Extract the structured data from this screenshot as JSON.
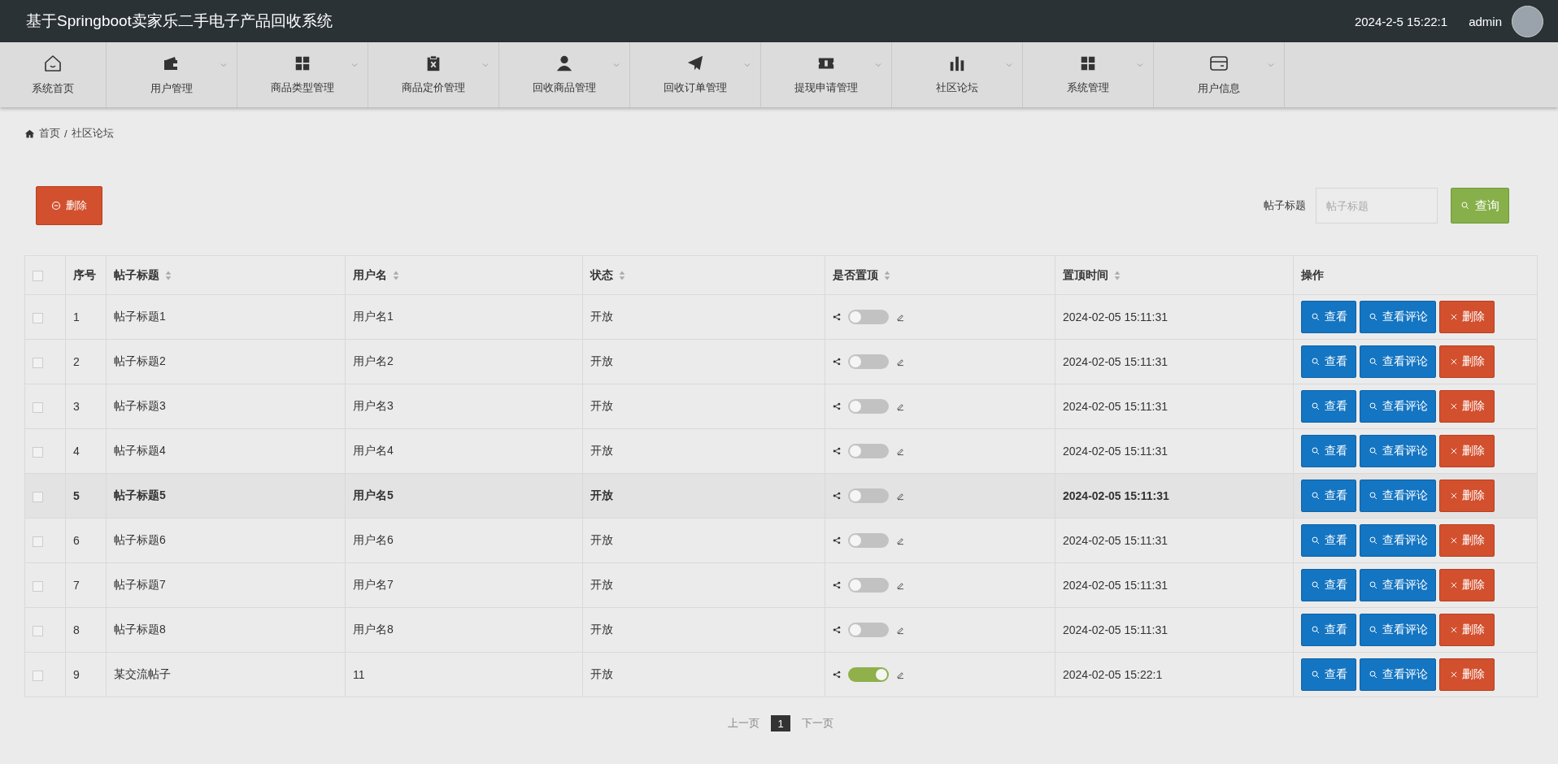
{
  "header": {
    "title": "基于Springboot卖家乐二手电子产品回收系统",
    "datetime": "2024-2-5 15:22:1",
    "user": "admin"
  },
  "nav": [
    {
      "label": "系统首页",
      "dropdown": false
    },
    {
      "label": "用户管理",
      "dropdown": true
    },
    {
      "label": "商品类型管理",
      "dropdown": true
    },
    {
      "label": "商品定价管理",
      "dropdown": true
    },
    {
      "label": "回收商品管理",
      "dropdown": true
    },
    {
      "label": "回收订单管理",
      "dropdown": true
    },
    {
      "label": "提现申请管理",
      "dropdown": true
    },
    {
      "label": "社区论坛",
      "dropdown": true
    },
    {
      "label": "系统管理",
      "dropdown": true
    },
    {
      "label": "用户信息",
      "dropdown": true
    }
  ],
  "breadcrumb": [
    "首页",
    "/",
    "社区论坛"
  ],
  "toolbar": {
    "delete_button": "删除",
    "search_label": "帖子标题",
    "search": {
      "placeholder": "帖子标题"
    },
    "query_button": "查询"
  },
  "table": {
    "select_all_checked": false,
    "columns": [
      {
        "label": "序号",
        "sortable": false
      },
      {
        "label": "帖子标题",
        "sortable": true
      },
      {
        "label": "用户名",
        "sortable": true
      },
      {
        "label": "状态",
        "sortable": true
      },
      {
        "label": "是否置顶",
        "sortable": true
      },
      {
        "label": "置顶时间",
        "sortable": true
      },
      {
        "label": "操作",
        "sortable": false
      }
    ],
    "rows": [
      {
        "checked": false,
        "selected": false,
        "index": "1",
        "title": "帖子标题1",
        "username": "用户名1",
        "status": "开放",
        "pinned": false,
        "time": "2024-02-05 15:11:31",
        "actions": [
          "查看",
          "查看评论",
          "删除"
        ]
      },
      {
        "checked": false,
        "selected": false,
        "index": "2",
        "title": "帖子标题2",
        "username": "用户名2",
        "status": "开放",
        "pinned": false,
        "time": "2024-02-05 15:11:31",
        "actions": [
          "查看",
          "查看评论",
          "删除"
        ]
      },
      {
        "checked": false,
        "selected": false,
        "index": "3",
        "title": "帖子标题3",
        "username": "用户名3",
        "status": "开放",
        "pinned": false,
        "time": "2024-02-05 15:11:31",
        "actions": [
          "查看",
          "查看评论",
          "删除"
        ]
      },
      {
        "checked": false,
        "selected": false,
        "index": "4",
        "title": "帖子标题4",
        "username": "用户名4",
        "status": "开放",
        "pinned": false,
        "time": "2024-02-05 15:11:31",
        "actions": [
          "查看",
          "查看评论",
          "删除"
        ]
      },
      {
        "checked": false,
        "selected": true,
        "index": "5",
        "title": "帖子标题5",
        "username": "用户名5",
        "status": "开放",
        "pinned": false,
        "time": "2024-02-05 15:11:31",
        "actions": [
          "查看",
          "查看评论",
          "删除"
        ]
      },
      {
        "checked": false,
        "selected": false,
        "index": "6",
        "title": "帖子标题6",
        "username": "用户名6",
        "status": "开放",
        "pinned": false,
        "time": "2024-02-05 15:11:31",
        "actions": [
          "查看",
          "查看评论",
          "删除"
        ]
      },
      {
        "checked": false,
        "selected": false,
        "index": "7",
        "title": "帖子标题7",
        "username": "用户名7",
        "status": "开放",
        "pinned": false,
        "time": "2024-02-05 15:11:31",
        "actions": [
          "查看",
          "查看评论",
          "删除"
        ]
      },
      {
        "checked": false,
        "selected": false,
        "index": "8",
        "title": "帖子标题8",
        "username": "用户名8",
        "status": "开放",
        "pinned": false,
        "time": "2024-02-05 15:11:31",
        "actions": [
          "查看",
          "查看评论",
          "删除"
        ]
      },
      {
        "checked": false,
        "selected": false,
        "index": "9",
        "title": "某交流帖子",
        "username": "11",
        "status": "开放",
        "pinned": true,
        "time": "2024-02-05 15:22:1",
        "actions": [
          "查看",
          "查看评论",
          "删除"
        ]
      }
    ]
  },
  "pagination": {
    "prev": "上一页",
    "pages": [
      {
        "label": "1",
        "selected": true
      }
    ],
    "next": "下一页"
  }
}
